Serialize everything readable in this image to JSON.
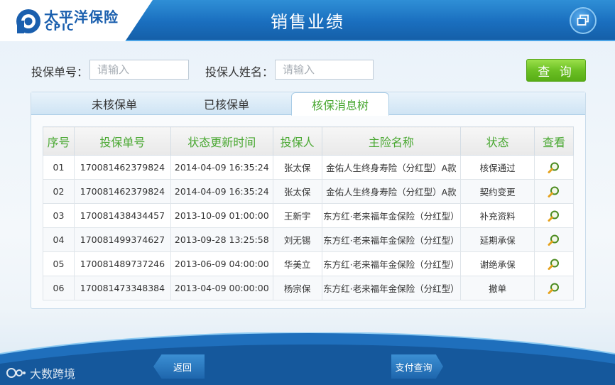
{
  "header": {
    "logo_cn": "太平洋保险",
    "logo_en": "CPIC",
    "title": "销售业绩",
    "window_icon": "restore-window-icon"
  },
  "search": {
    "policy_no_label": "投保单号：",
    "policy_no_placeholder": "请输入",
    "holder_label": "投保人姓名：",
    "holder_placeholder": "请输入",
    "query_label": "查 询"
  },
  "tabs": [
    {
      "label": "未核保单",
      "active": false
    },
    {
      "label": "已核保单",
      "active": false
    },
    {
      "label": "核保消息树",
      "active": true
    }
  ],
  "table": {
    "headers": [
      "序号",
      "投保单号",
      "状态更新时间",
      "投保人",
      "主险名称",
      "状态",
      "查看"
    ],
    "rows": [
      {
        "no": "01",
        "policy": "170081462379824",
        "time": "2014-04-09 16:35:24",
        "holder": "张太保",
        "product": "金佑人生终身寿险（分红型）A款",
        "status": "核保通过"
      },
      {
        "no": "02",
        "policy": "170081462379824",
        "time": "2014-04-09 16:35:24",
        "holder": "张太保",
        "product": "金佑人生终身寿险（分红型）A款",
        "status": "契约变更"
      },
      {
        "no": "03",
        "policy": "170081438434457",
        "time": "2013-10-09 01:00:00",
        "holder": "王新宇",
        "product": "东方红·老来福年金保险（分红型）",
        "status": "补充资料"
      },
      {
        "no": "04",
        "policy": "170081499374627",
        "time": "2013-09-28 13:25:58",
        "holder": "刘无锡",
        "product": "东方红·老来福年金保险（分红型）",
        "status": "延期承保"
      },
      {
        "no": "05",
        "policy": "170081489737246",
        "time": "2013-06-09 04:00:00",
        "holder": "华美立",
        "product": "东方红·老来福年金保险（分红型）",
        "status": "谢绝承保"
      },
      {
        "no": "06",
        "policy": "170081473348384",
        "time": "2013-04-09 00:00:00",
        "holder": "杨宗保",
        "product": "东方红·老来福年金保险（分红型）",
        "status": "撤单"
      }
    ]
  },
  "footer": {
    "back_label": "返回",
    "pay_query_label": "支付查询",
    "watermark": "大数跨境"
  },
  "colors": {
    "brand_blue": "#1a6fbf",
    "accent_green": "#4aa832",
    "query_green": "#6cc024"
  }
}
